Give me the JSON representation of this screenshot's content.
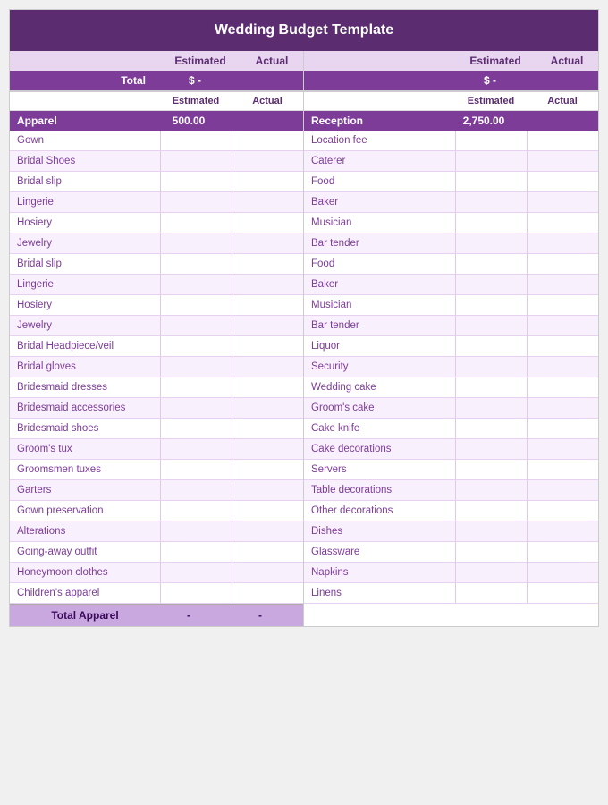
{
  "title": "Wedding Budget Template",
  "summary": {
    "estimated_label": "Estimated",
    "actual_label": "Actual",
    "total_label": "Total",
    "total_est": "$ -",
    "total_act": "$ -"
  },
  "left": {
    "col_headers": {
      "estimated": "Estimated",
      "actual": "Actual"
    },
    "section_header": {
      "label": "Apparel",
      "estimated": "500.00",
      "actual": ""
    },
    "rows": [
      "Gown",
      "Bridal Shoes",
      "Bridal slip",
      "Lingerie",
      "Hosiery",
      "Jewelry",
      "Bridal slip",
      "Lingerie",
      "Hosiery",
      "Jewelry",
      "Bridal Headpiece/veil",
      "Bridal gloves",
      "Bridesmaid dresses",
      "Bridesmaid accessories",
      "Bridesmaid shoes",
      "Groom's tux",
      "Groomsmen tuxes",
      "Garters",
      "Gown preservation",
      "Alterations",
      "Going-away outfit",
      "Honeymoon clothes",
      "Children's apparel"
    ],
    "footer": {
      "label": "Total Apparel",
      "estimated": "-",
      "actual": "-"
    }
  },
  "right": {
    "col_headers": {
      "estimated": "Estimated",
      "actual": "Actual"
    },
    "section_header": {
      "label": "Reception",
      "estimated": "2,750.00",
      "actual": ""
    },
    "rows": [
      "Location fee",
      "Caterer",
      "Food",
      "Baker",
      "Musician",
      "Bar tender",
      "Food",
      "Baker",
      "Musician",
      "Bar tender",
      "Liquor",
      "Security",
      "Wedding cake",
      "Groom's cake",
      "Cake knife",
      "Cake decorations",
      "Servers",
      "Table decorations",
      "Other decorations",
      "Dishes",
      "Glassware",
      "Napkins",
      "Linens"
    ]
  }
}
